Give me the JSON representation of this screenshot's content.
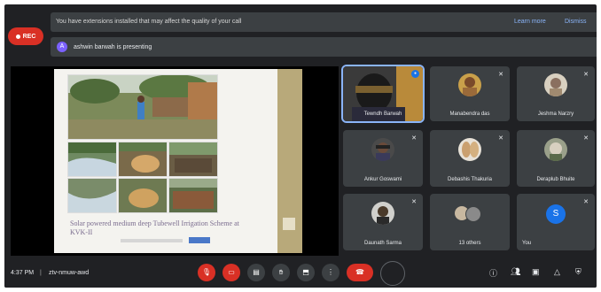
{
  "meeting": {
    "rec_label": "REC",
    "banner_text": "You have extensions installed that may affect the quality of your call",
    "banner_link1": "Learn more",
    "banner_link2": "Dismiss",
    "presenting_avatar": "A",
    "presenting_text": "ashwin barwah is presenting",
    "time": "4:37 PM",
    "meeting_code": "ztv-nmuw-awd"
  },
  "slide": {
    "title": "Solar powered medium deep Tubewell Irrigation Scheme at KVK-II"
  },
  "tiles": [
    {
      "name": "Tewndh Barwah"
    },
    {
      "name": "Manabendra das"
    },
    {
      "name": "Jeshma Narzry"
    },
    {
      "name": "Ankur Goswami"
    },
    {
      "name": "Debashis Thakuria"
    },
    {
      "name": "Deraplub Bhuite"
    },
    {
      "name": "Daunath Sarma"
    },
    {
      "name": "13 others"
    },
    {
      "name": "You",
      "initial": "S"
    }
  ],
  "icons": {
    "mic": "mic-off-icon",
    "cam": "camera-off-icon",
    "cc": "captions-icon",
    "hand": "raise-hand-icon",
    "present": "present-icon",
    "more": "more-options-icon",
    "end": "end-call-icon",
    "info": "info-icon",
    "people": "people-icon",
    "chat": "chat-icon",
    "activities": "activities-icon",
    "safety": "host-controls-icon"
  },
  "colors": {
    "background": "#202124",
    "tile": "#3c4043",
    "accent_red": "#d93025",
    "link": "#8ab4f8"
  }
}
